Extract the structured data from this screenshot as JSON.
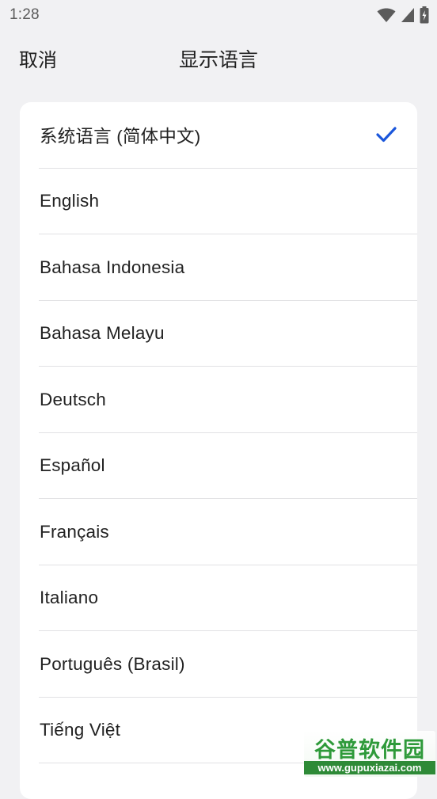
{
  "status_bar": {
    "time": "1:28",
    "icons": [
      "wifi-icon",
      "cellular-signal-icon",
      "battery-charging-icon"
    ]
  },
  "header": {
    "cancel_label": "取消",
    "title": "显示语言"
  },
  "languages": [
    {
      "label": "系统语言 (简体中文)",
      "selected": true
    },
    {
      "label": "English",
      "selected": false
    },
    {
      "label": "Bahasa Indonesia",
      "selected": false
    },
    {
      "label": "Bahasa Melayu",
      "selected": false
    },
    {
      "label": "Deutsch",
      "selected": false
    },
    {
      "label": "Español",
      "selected": false
    },
    {
      "label": "Français",
      "selected": false
    },
    {
      "label": "Italiano",
      "selected": false
    },
    {
      "label": "Português (Brasil)",
      "selected": false
    },
    {
      "label": "Tiếng Việt",
      "selected": false
    }
  ],
  "colors": {
    "background": "#f1f1f3",
    "card": "#ffffff",
    "accent": "#1a56db",
    "divider": "#e2e2e4"
  },
  "watermark": {
    "top": "谷普软件园",
    "bottom": "www.gupuxiazai.com"
  }
}
